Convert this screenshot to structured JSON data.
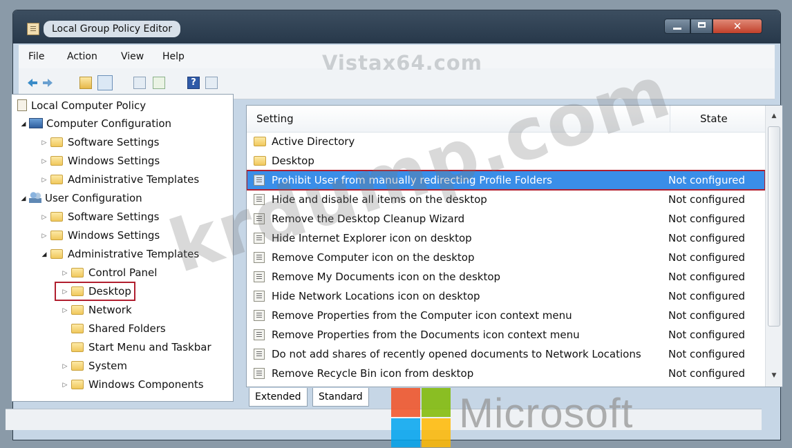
{
  "window": {
    "title": "Local Group Policy Editor"
  },
  "menu": [
    "File",
    "Action",
    "View",
    "Help"
  ],
  "watermarks": {
    "top": "Vistax64.com",
    "diagonal": "krdump.com",
    "brand": "Microsoft"
  },
  "tree": {
    "root": "Local Computer Policy",
    "computer_config": "Computer Configuration",
    "user_config": "User Configuration",
    "computer_children": [
      "Software Settings",
      "Windows Settings",
      "Administrative Templates"
    ],
    "user_children": [
      "Software Settings",
      "Windows Settings",
      "Administrative Templates"
    ],
    "admin_templates_children": [
      "Control Panel",
      "Desktop",
      "Network",
      "Shared Folders",
      "Start Menu and Taskbar",
      "System",
      "Windows Components"
    ]
  },
  "table": {
    "headers": {
      "setting": "Setting",
      "state": "State"
    },
    "rows": [
      {
        "name": "Active Directory",
        "state": "",
        "type": "folder"
      },
      {
        "name": "Desktop",
        "state": "",
        "type": "folder"
      },
      {
        "name": "Prohibit User from manually redirecting Profile Folders",
        "state": "Not configured",
        "type": "policy"
      },
      {
        "name": "Hide and disable all items on the desktop",
        "state": "Not configured",
        "type": "policy"
      },
      {
        "name": "Remove the Desktop Cleanup Wizard",
        "state": "Not configured",
        "type": "policy"
      },
      {
        "name": "Hide Internet Explorer icon on desktop",
        "state": "Not configured",
        "type": "policy"
      },
      {
        "name": "Remove Computer icon on the desktop",
        "state": "Not configured",
        "type": "policy"
      },
      {
        "name": "Remove My Documents icon on the desktop",
        "state": "Not configured",
        "type": "policy"
      },
      {
        "name": "Hide Network Locations icon on desktop",
        "state": "Not configured",
        "type": "policy"
      },
      {
        "name": "Remove Properties from the Computer icon context menu",
        "state": "Not configured",
        "type": "policy"
      },
      {
        "name": "Remove Properties from the Documents icon context menu",
        "state": "Not configured",
        "type": "policy"
      },
      {
        "name": "Do not add shares of recently opened documents to Network Locations",
        "state": "Not configured",
        "type": "policy"
      },
      {
        "name": "Remove Recycle Bin icon from desktop",
        "state": "Not configured",
        "type": "policy"
      }
    ]
  },
  "tabs": [
    "Extended",
    "Standard"
  ],
  "colors": {
    "selection": "#3a8ee8",
    "highlight_box": "#b01e2e",
    "ms_red": "#f25022",
    "ms_green": "#7fba00",
    "ms_blue": "#00a4ef",
    "ms_yellow": "#ffb900"
  }
}
